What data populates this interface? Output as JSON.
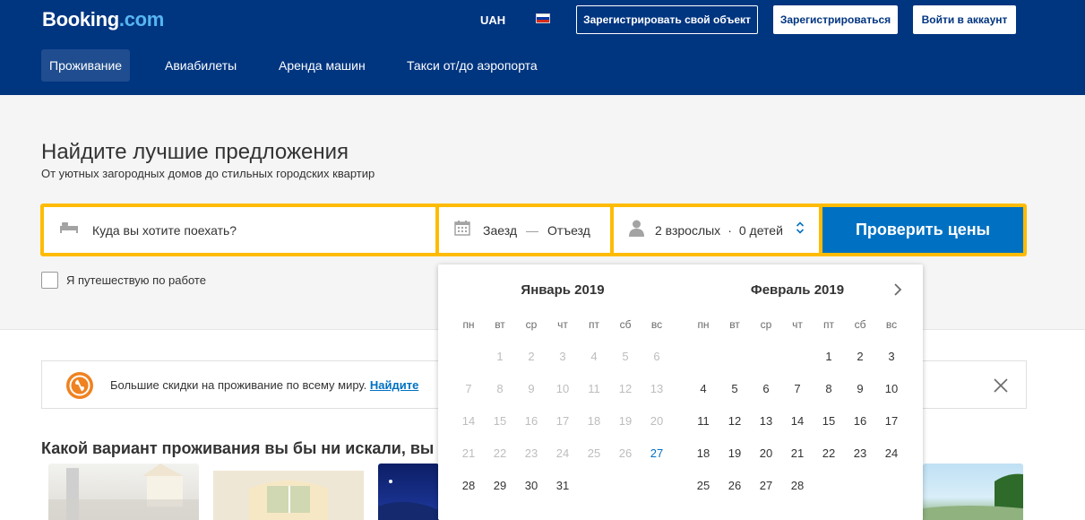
{
  "header": {
    "logo_main": "Booking",
    "logo_suffix": ".com",
    "currency": "UAH",
    "list_property": "Зарегистрировать свой объект",
    "register": "Зарегистрироваться",
    "login": "Войти в аккаунт",
    "nav": [
      "Проживание",
      "Авиабилеты",
      "Аренда машин",
      "Такси от/до аэропорта"
    ]
  },
  "hero": {
    "title": "Найдите лучшие предложения",
    "subtitle": "От уютных загородных домов до стильных городских квартир"
  },
  "search": {
    "destination_placeholder": "Куда вы хотите поехать?",
    "checkin": "Заезд",
    "dash": "—",
    "checkout": "Отъезд",
    "adults": "2 взрослых",
    "dot": "·",
    "children": "0 детей",
    "submit": "Проверить цены"
  },
  "work_travel_label": "Я путешествую по работе",
  "banner": {
    "text": "Большие скидки на проживание по всему миру. ",
    "link": "Найдите"
  },
  "section_title": "Какой вариант проживания вы бы ни искали, вы",
  "calendar": {
    "weekdays": [
      "пн",
      "вт",
      "ср",
      "чт",
      "пт",
      "сб",
      "вс"
    ],
    "months": [
      {
        "title": "Январь 2019",
        "weeks": [
          [
            "",
            "1",
            "2",
            "3",
            "4",
            "5",
            "6"
          ],
          [
            "7",
            "8",
            "9",
            "10",
            "11",
            "12",
            "13"
          ],
          [
            "14",
            "15",
            "16",
            "17",
            "18",
            "19",
            "20"
          ],
          [
            "21",
            "22",
            "23",
            "24",
            "25",
            "26",
            "27"
          ],
          [
            "28",
            "29",
            "30",
            "31",
            "",
            "",
            ""
          ]
        ]
      },
      {
        "title": "Февраль 2019",
        "weeks": [
          [
            "",
            "",
            "",
            "",
            "1",
            "2",
            "3"
          ],
          [
            "4",
            "5",
            "6",
            "7",
            "8",
            "9",
            "10"
          ],
          [
            "11",
            "12",
            "13",
            "14",
            "15",
            "16",
            "17"
          ],
          [
            "18",
            "19",
            "20",
            "21",
            "22",
            "23",
            "24"
          ],
          [
            "25",
            "26",
            "27",
            "28",
            "",
            "",
            ""
          ]
        ]
      }
    ],
    "today": "27",
    "colors": {
      "past": "#bdbdbd",
      "today": "#0071c2",
      "available": "#333333"
    }
  },
  "colors": {
    "header_bg": "#003580",
    "accent_yellow": "#febb02",
    "primary_blue": "#0071c2"
  },
  "icons": {
    "destination": "bed-icon",
    "dates": "calendar-icon",
    "guests": "person-icon",
    "guests_toggle": "sort-arrows-icon",
    "banner": "discount-badge-icon",
    "close": "close-icon",
    "next": "chevron-right-icon"
  }
}
